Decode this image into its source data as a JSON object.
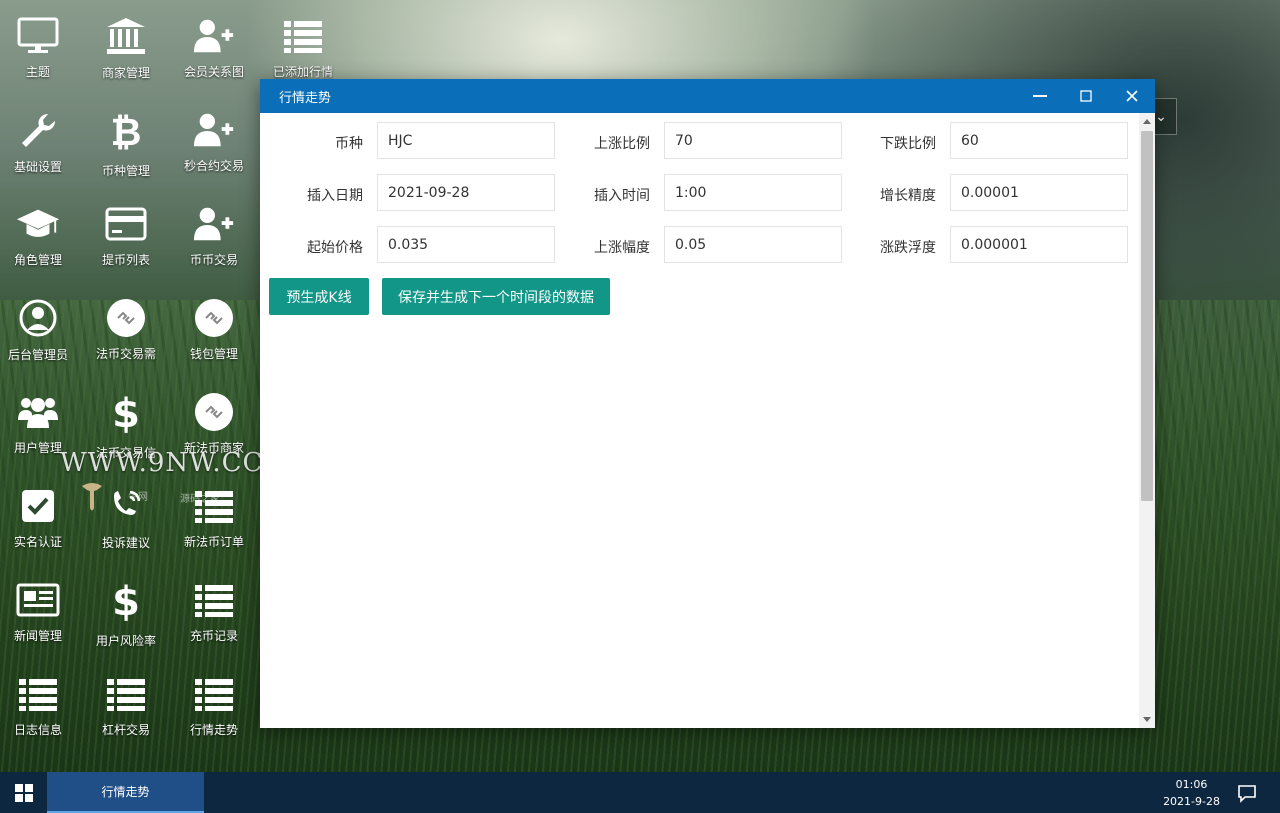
{
  "desktop": {
    "icons": [
      {
        "label": "主题",
        "icon": "monitor-icon"
      },
      {
        "label": "商家管理",
        "icon": "bank-icon"
      },
      {
        "label": "会员关系图",
        "icon": "user-add-icon"
      },
      {
        "label": "已添加行情",
        "icon": "list-icon"
      },
      {
        "label": "基础设置",
        "icon": "wrench-icon"
      },
      {
        "label": "币种管理",
        "icon": "bitcoin-icon"
      },
      {
        "label": "秒合约交易",
        "icon": "user-add-icon"
      },
      {
        "label": "角色管理",
        "icon": "graduation-cap-icon"
      },
      {
        "label": "提币列表",
        "icon": "credit-card-icon"
      },
      {
        "label": "币币交易",
        "icon": "user-add-icon"
      },
      {
        "label": "后台管理员",
        "icon": "user-circle-icon"
      },
      {
        "label": "法币交易需",
        "icon": "exchange-circle-icon"
      },
      {
        "label": "钱包管理",
        "icon": "exchange-circle-icon"
      },
      {
        "label": "用户管理",
        "icon": "users-icon"
      },
      {
        "label": "法币交易信",
        "icon": "dollar-icon"
      },
      {
        "label": "新法币商家",
        "icon": "exchange-circle-icon"
      },
      {
        "label": "实名认证",
        "icon": "checkbox-icon"
      },
      {
        "label": "投诉建议",
        "icon": "phone-icon"
      },
      {
        "label": "新法币订单",
        "icon": "list-icon"
      },
      {
        "label": "新闻管理",
        "icon": "newspaper-icon"
      },
      {
        "label": "用户风险率",
        "icon": "dollar-icon"
      },
      {
        "label": "充币记录",
        "icon": "list-icon"
      },
      {
        "label": "日志信息",
        "icon": "list-icon"
      },
      {
        "label": "杠杆交易",
        "icon": "list-icon"
      },
      {
        "label": "行情走势",
        "icon": "list-icon"
      }
    ]
  },
  "watermark": {
    "text": "WWW.9NW.CC",
    "sub1": "牛网",
    "sub2": "源码之家"
  },
  "window": {
    "title": "行情走势",
    "controls": {
      "minimize": "—",
      "maximize": "□",
      "close": "✕"
    },
    "form": {
      "coin": {
        "label": "币种",
        "value": "HJC"
      },
      "up_ratio": {
        "label": "上涨比例",
        "value": "70"
      },
      "down_ratio": {
        "label": "下跌比例",
        "value": "60"
      },
      "insert_date": {
        "label": "插入日期",
        "value": "2021-09-28"
      },
      "insert_time": {
        "label": "插入时间",
        "value": "1:00"
      },
      "growth_precision": {
        "label": "增长精度",
        "value": "0.00001"
      },
      "start_price": {
        "label": "起始价格",
        "value": "0.035"
      },
      "up_range": {
        "label": "上涨幅度",
        "value": "0.05"
      },
      "fluctuation": {
        "label": "涨跌浮度",
        "value": "0.000001"
      }
    },
    "buttons": {
      "pregenerate": "预生成K线",
      "save_next": "保存并生成下一个时间段的数据"
    }
  },
  "taskbar": {
    "task_label": "行情走势",
    "time": "01:06",
    "date": "2021-9-28"
  }
}
